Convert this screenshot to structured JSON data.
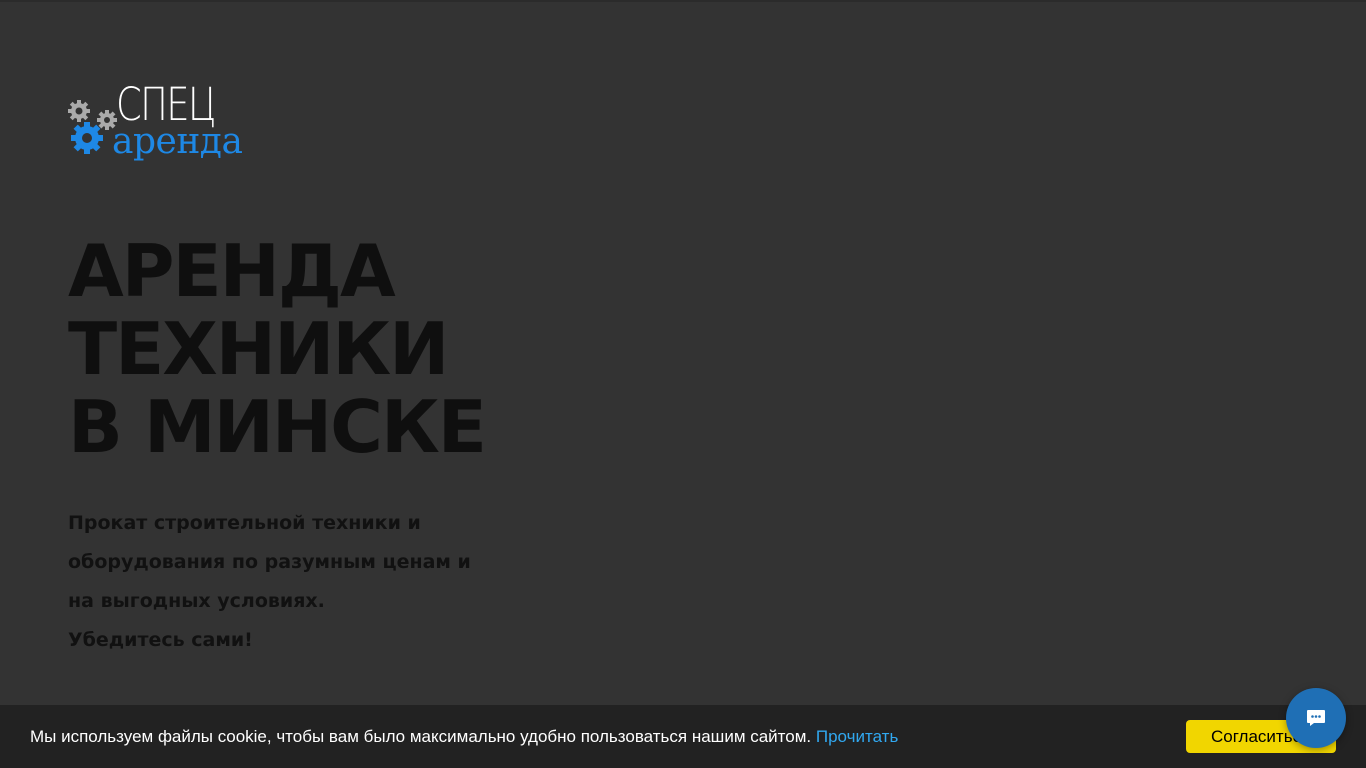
{
  "logo": {
    "brand_top": "СПЕЦ",
    "brand_bottom": "аренда",
    "icon": "gears-icon",
    "colors": {
      "top": "#ffffff",
      "bottom": "#1e88e5",
      "gear_gray": "#aaaaaa",
      "gear_blue": "#1e88e5"
    }
  },
  "hero": {
    "headline_lines": [
      "АРЕНДА",
      "ТЕХНИКИ",
      "В МИНСКЕ"
    ],
    "subtext_lines": [
      "Прокат строительной техники и",
      "оборудования по разумным ценам и",
      "на выгодных условиях.",
      "Убедитесь сами!"
    ]
  },
  "cookie": {
    "message": "Мы используем файлы cookie, чтобы вам было максимально удобно пользоваться нашим сайтом.",
    "link_label": "Прочитать",
    "accept_label": "Согласиться",
    "colors": {
      "bar": "#222222",
      "link": "#31a8f0",
      "button": "#f1d600"
    }
  },
  "chat": {
    "icon": "chat-bubble-icon",
    "color": "#1f6fb5"
  },
  "colors": {
    "background": "#333333"
  }
}
